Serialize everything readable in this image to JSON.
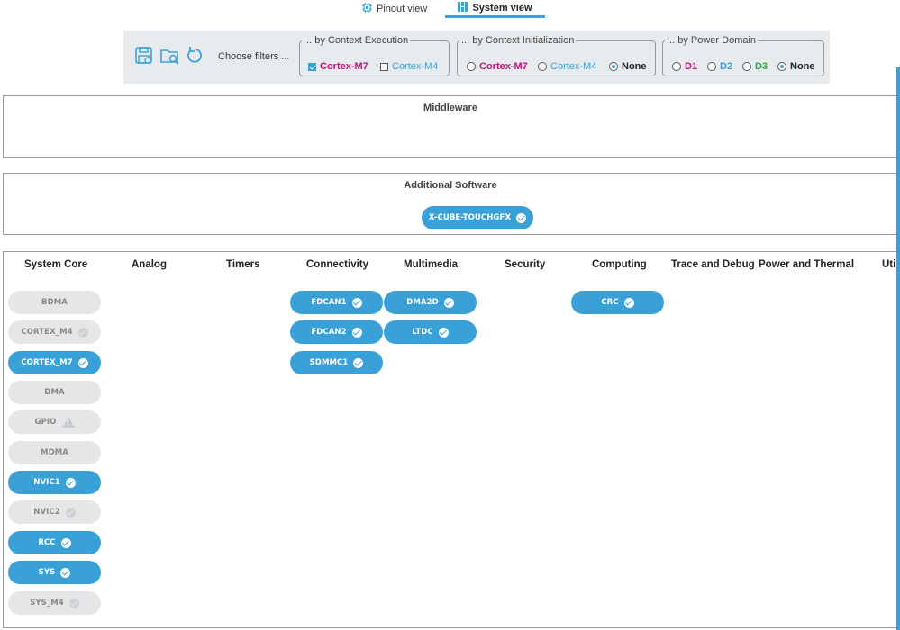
{
  "tabs": {
    "pinout": {
      "label": "Pinout view",
      "icon": "chip-icon"
    },
    "system": {
      "label": "System view",
      "icon": "grid-icon"
    }
  },
  "toolbar": {
    "icons": [
      "save-icon",
      "open-folder-icon",
      "refresh-icon"
    ],
    "choose_filters": "Choose filters ...",
    "context_execution": {
      "legend": "... by Context Execution",
      "options": [
        {
          "label": "Cortex-M7",
          "checked": true,
          "color": "#c8127a"
        },
        {
          "label": "Cortex-M4",
          "checked": false,
          "color": "#3aa1d8"
        }
      ]
    },
    "context_initialization": {
      "legend": "... by Context Initialization",
      "options": [
        {
          "label": "Cortex-M7",
          "selected": false,
          "color": "#c8127a"
        },
        {
          "label": "Cortex-M4",
          "selected": false,
          "color": "#3aa1d8"
        },
        {
          "label": "None",
          "selected": true,
          "color": "#222222"
        }
      ]
    },
    "power_domain": {
      "legend": "... by Power Domain",
      "options": [
        {
          "label": "D1",
          "selected": false,
          "color": "#c8127a"
        },
        {
          "label": "D2",
          "selected": false,
          "color": "#3aa1d8"
        },
        {
          "label": "D3",
          "selected": false,
          "color": "#2ea84a"
        },
        {
          "label": "None",
          "selected": true,
          "color": "#222222"
        }
      ]
    }
  },
  "middleware": {
    "title": "Middleware"
  },
  "additional_software": {
    "title": "Additional Software",
    "items": [
      {
        "label": "X-CUBE-TOUCHGFX",
        "status": "ok"
      }
    ]
  },
  "categories": {
    "columns": [
      "System Core",
      "Analog",
      "Timers",
      "Connectivity",
      "Multimedia",
      "Security",
      "Computing",
      "Trace and Debug",
      "Power and Thermal",
      "Util"
    ],
    "system_core": [
      {
        "label": "BDMA",
        "active": false,
        "status": "none"
      },
      {
        "label": "CORTEX_M4",
        "active": false,
        "status": "ok-grey"
      },
      {
        "label": "CORTEX_M7",
        "active": true,
        "status": "ok"
      },
      {
        "label": "DMA",
        "active": false,
        "status": "none"
      },
      {
        "label": "GPIO",
        "active": false,
        "status": "warn"
      },
      {
        "label": "MDMA",
        "active": false,
        "status": "none"
      },
      {
        "label": "NVIC1",
        "active": true,
        "status": "ok"
      },
      {
        "label": "NVIC2",
        "active": false,
        "status": "ok-grey"
      },
      {
        "label": "RCC",
        "active": true,
        "status": "ok"
      },
      {
        "label": "SYS",
        "active": true,
        "status": "ok"
      },
      {
        "label": "SYS_M4",
        "active": false,
        "status": "ok-grey"
      }
    ],
    "connectivity": [
      {
        "label": "FDCAN1",
        "active": true,
        "status": "ok"
      },
      {
        "label": "FDCAN2",
        "active": true,
        "status": "ok"
      },
      {
        "label": "SDMMC1",
        "active": true,
        "status": "ok"
      }
    ],
    "multimedia": [
      {
        "label": "DMA2D",
        "active": true,
        "status": "ok"
      },
      {
        "label": "LTDC",
        "active": true,
        "status": "ok"
      }
    ],
    "computing": [
      {
        "label": "CRC",
        "active": true,
        "status": "ok"
      }
    ]
  },
  "colors": {
    "accent": "#3aa1d8",
    "m7": "#c8127a",
    "m4": "#3aa1d8",
    "d3": "#2ea84a"
  }
}
